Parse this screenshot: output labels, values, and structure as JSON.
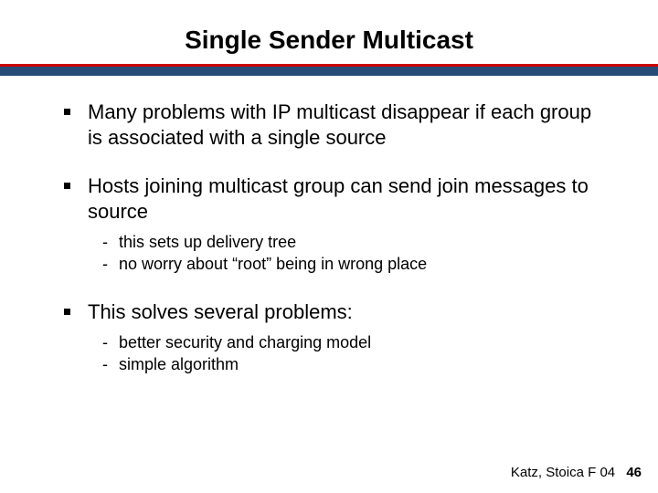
{
  "title": "Single Sender Multicast",
  "bullets": {
    "b1": "Many problems with IP multicast disappear if each group is associated with a single source",
    "b2": "Hosts joining multicast group can send join messages to source",
    "b2_sub1": "this sets up delivery tree",
    "b2_sub2": "no worry about “root” being in wrong place",
    "b3": "This solves several problems:",
    "b3_sub1": "better security and charging model",
    "b3_sub2": "simple algorithm"
  },
  "footer": {
    "credit": "Katz, Stoica F 04",
    "page": "46"
  }
}
